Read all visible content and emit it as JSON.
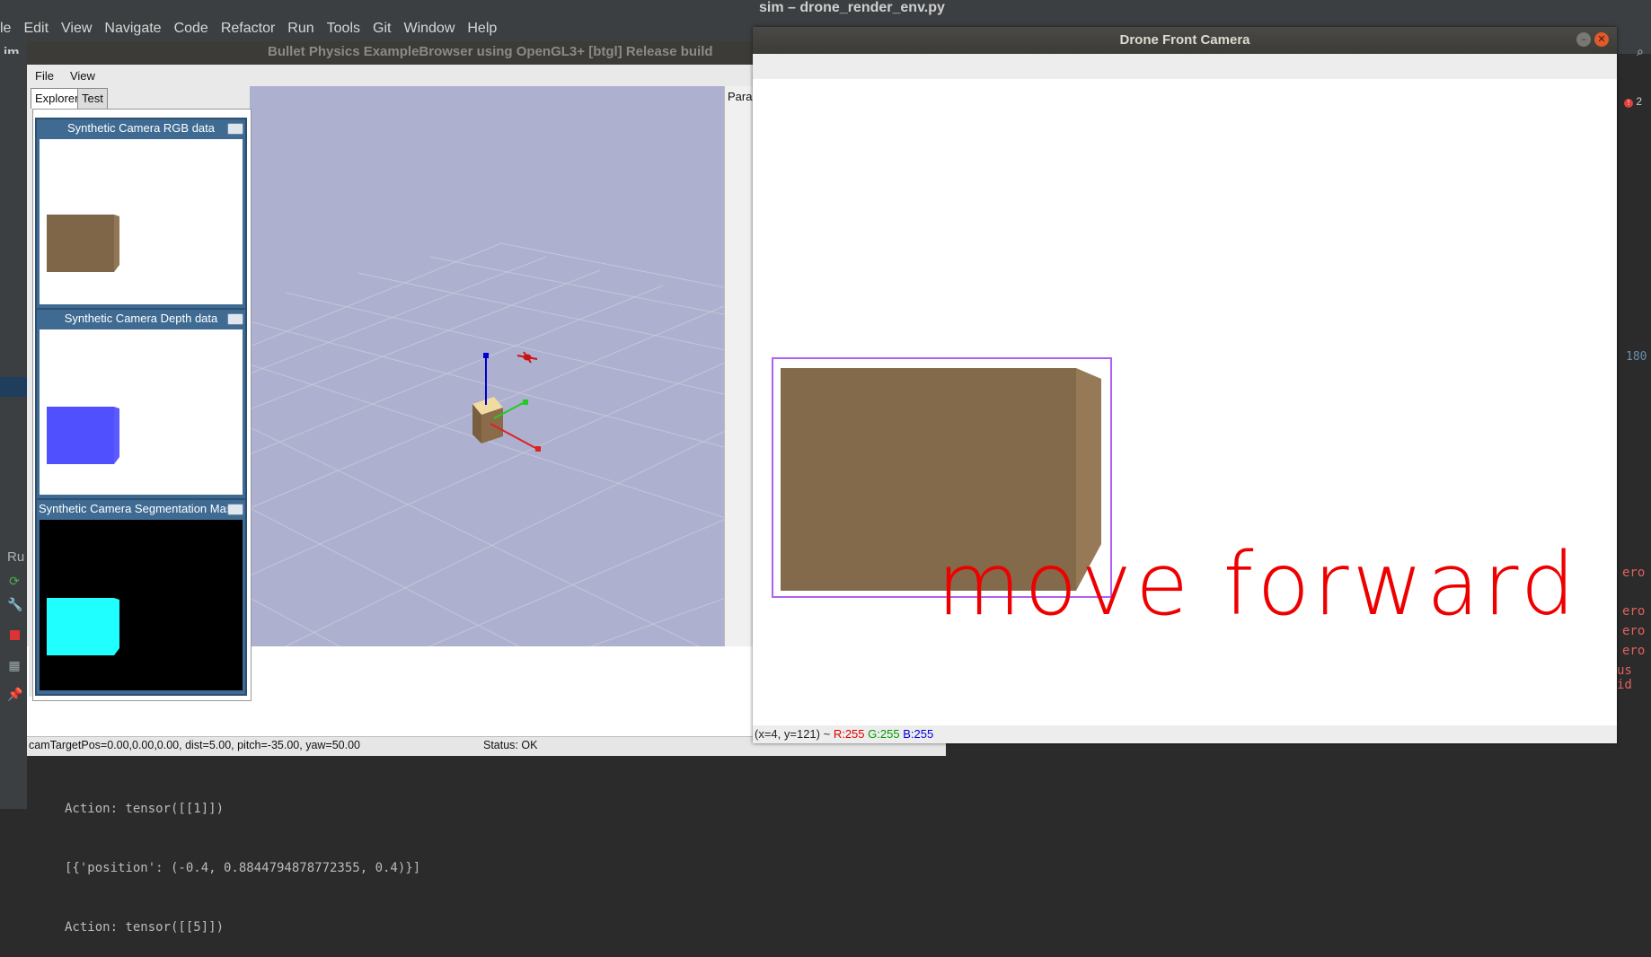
{
  "ide": {
    "window_title": "sim – drone_render_env.py",
    "menu": [
      "le",
      "Edit",
      "View",
      "Navigate",
      "Code",
      "Refactor",
      "Run",
      "Tools",
      "Git",
      "Window",
      "Help"
    ],
    "project_label": "im",
    "run_label": "Ru",
    "console_lines": [
      "Action: tensor([[1]])",
      "[{'position': (-0.4, 0.8844794878772355, 0.4)}]",
      "Action: tensor([[5]])"
    ],
    "error_count": "2",
    "right_snippets": [
      "ero",
      "ero",
      "ero",
      "ero",
      "us id"
    ],
    "side_number": "180"
  },
  "bullet": {
    "title": "Bullet Physics ExampleBrowser using OpenGL3+ [btgl] Release build",
    "menu": [
      "File",
      "View"
    ],
    "tabs": [
      "Explorer",
      "Test"
    ],
    "params_label": "Paran",
    "status_left": "camTargetPos=0.00,0.00,0.00, dist=5.00, pitch=-35.00, yaw=50.00",
    "status_right": "Status: OK",
    "cam_windows": [
      {
        "title": "Synthetic Camera RGB data",
        "bg": "#ffffff",
        "box_color": "#806648"
      },
      {
        "title": "Synthetic Camera Depth data",
        "bg": "#ffffff",
        "box_color": "#5050ff"
      },
      {
        "title": "Synthetic Camera Segmentation Mask",
        "bg": "#000000",
        "box_color": "#20ffff"
      }
    ]
  },
  "drone": {
    "title": "Drone Front Camera",
    "overlay_text": "move forward",
    "status": {
      "coords": "(x=4, y=121) ~",
      "r": "R:255",
      "g": "G:255",
      "b": "B:255"
    },
    "colors": {
      "overlay": "#ee0000",
      "bbox": "#b060f0",
      "box_front": "#836a4a",
      "box_side": "#967a58"
    }
  }
}
